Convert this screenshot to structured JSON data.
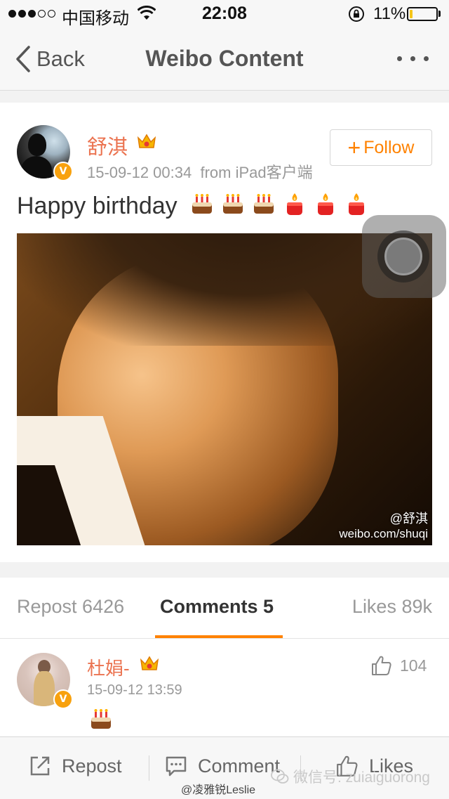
{
  "status_bar": {
    "carrier": "中国移动",
    "time": "22:08",
    "battery_percent": "11%",
    "battery_level": 0.11
  },
  "nav": {
    "back_label": "Back",
    "title": "Weibo Content"
  },
  "post": {
    "author": "舒淇",
    "timestamp": "15-09-12 00:34",
    "source": "from iPad客户端",
    "follow_label": "Follow",
    "text": "Happy birthday",
    "emoji_icons": [
      "cake-emoji",
      "cake-emoji",
      "cake-emoji",
      "candle-emoji",
      "candle-emoji",
      "candle-emoji"
    ],
    "photo_watermark_user": "@舒淇",
    "photo_watermark_url": "weibo.com/shuqi"
  },
  "tabs": {
    "repost": "Repost 6426",
    "comments": "Comments 5",
    "likes": "Likes 89k"
  },
  "comment": {
    "author": "杜娟-",
    "timestamp": "15-09-12 13:59",
    "like_count": "104"
  },
  "toolbar": {
    "repost_label": "Repost",
    "comment_label": "Comment",
    "like_label": "Likes"
  },
  "overlay_watermark": {
    "wechat_id": "微信号: zuiaiguorong",
    "handle": "@凌雅锐Leslie"
  },
  "colors": {
    "accent": "#ff8200",
    "username": "#eb7350",
    "verified_badge": "#f8a10e"
  }
}
